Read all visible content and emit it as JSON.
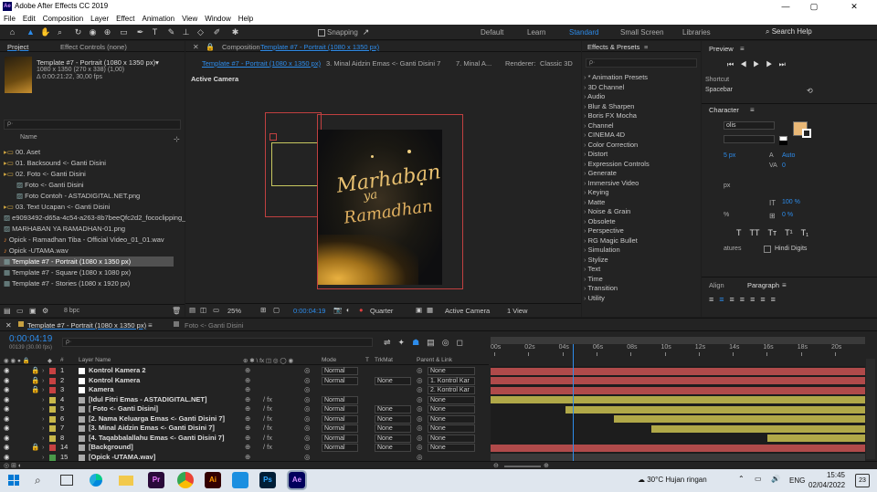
{
  "window": {
    "title": "Adobe After Effects CC 2019",
    "logo": "Ae",
    "min": "—",
    "max": "▢",
    "close": "✕"
  },
  "menu": [
    "File",
    "Edit",
    "Composition",
    "Layer",
    "Effect",
    "Animation",
    "View",
    "Window",
    "Help"
  ],
  "toolbar": {
    "snapping": "Snapping",
    "workspaces": [
      "Default",
      "Learn",
      "Standard",
      "Small Screen",
      "Libraries"
    ],
    "search": "Search Help"
  },
  "project": {
    "tab": "Project",
    "effect_controls": "Effect Controls (none)",
    "comp_name": "Template #7 - Portrait (1080 x 1350 px)▾",
    "comp_info1": "1080 x 1350  (270 x 338) (1,00)",
    "comp_info2": "Δ 0:00:21:22, 30,00 fps",
    "search_placeholder": "ρ·",
    "col_name": "Name",
    "items": [
      {
        "label": "00. Aset",
        "indent": 0,
        "type": "folder"
      },
      {
        "label": "01. Backsound <- Ganti Disini",
        "indent": 0,
        "type": "folder"
      },
      {
        "label": "02. Foto <- Ganti Disini",
        "indent": 0,
        "type": "folder"
      },
      {
        "label": "Foto <- Ganti Disini",
        "indent": 1,
        "type": "image"
      },
      {
        "label": "Foto Contoh - ASTADIGITAL.NET.png",
        "indent": 1,
        "type": "image"
      },
      {
        "label": "03. Text Ucapan <- Ganti Disini",
        "indent": 0,
        "type": "folder"
      },
      {
        "label": "e9093492-d65a-4c54-a263-8b7beeQfc2d2_fococlipping_",
        "indent": 0,
        "type": "image"
      },
      {
        "label": "MARHABAN YA RAMADHAN-01.png",
        "indent": 0,
        "type": "image"
      },
      {
        "label": "Opick - Ramadhan Tiba - Official Video_01_01.wav",
        "indent": 0,
        "type": "audio"
      },
      {
        "label": "Opick -UTAMA.wav",
        "indent": 0,
        "type": "audio"
      },
      {
        "label": "Template #7 - Portrait (1080 x 1350 px)",
        "indent": 0,
        "type": "comp",
        "selected": true
      },
      {
        "label": "Template #7 - Square (1080 x 1080 px)",
        "indent": 0,
        "type": "comp"
      },
      {
        "label": "Template #7 - Stories (1080 x 1920 px)",
        "indent": 0,
        "type": "comp"
      }
    ],
    "bpc": "8 bpc"
  },
  "composition": {
    "tab_prefix": "Composition",
    "tab_name": "Template #7 - Portrait (1080 x 1350 px)",
    "flow": [
      "Template #7 - Portrait (1080 x 1350 px)",
      "3. Minal Aidzin Emas <- Ganti Disini 7",
      "7. Minal A..."
    ],
    "renderer_label": "Renderer:",
    "renderer": "Classic 3D",
    "active_camera": "Active Camera",
    "art_line1": "Marhaban",
    "art_line2": "ya",
    "art_line3": "Ramadhan",
    "footer": {
      "zoom": "25%",
      "time": "0:00:04:19",
      "quality": "Quarter",
      "camera": "Active Camera",
      "view": "1 View"
    }
  },
  "effects": {
    "title": "Effects & Presets",
    "search_placeholder": "ρ·",
    "list": [
      "* Animation Presets",
      "3D Channel",
      "Audio",
      "Blur & Sharpen",
      "Boris FX Mocha",
      "Channel",
      "CINEMA 4D",
      "Color Correction",
      "Distort",
      "Expression Controls",
      "Generate",
      "Immersive Video",
      "Keying",
      "Matte",
      "Noise & Grain",
      "Obsolete",
      "Perspective",
      "RG Magic Bullet",
      "Simulation",
      "Stylize",
      "Text",
      "Time",
      "Transition",
      "Utility"
    ]
  },
  "preview": {
    "title": "Preview",
    "shortcut_label": "Shortcut",
    "shortcut": "Spacebar"
  },
  "character": {
    "title": "Character",
    "font": "olis",
    "size": "5 px",
    "auto": "Auto",
    "kern": "0",
    "px": "px",
    "scale_v": "100 %",
    "scale_h": "%",
    "tsume": "0 %",
    "ligatures": "atures",
    "hindi": "Hindi Digits",
    "fill_color": "#e9b877",
    "styles": [
      "T",
      "TT",
      "Tт",
      "T¹",
      "T₁"
    ]
  },
  "paragraph": {
    "align": "Align",
    "title": "Paragraph"
  },
  "timeline": {
    "tab": "Template #7 - Portrait (1080 x 1350 px)",
    "tab2": "Foto <- Ganti Disini",
    "time": "0:00:04:19",
    "fps": "00139 (30.00 fps)",
    "col_layer": "Layer Name",
    "col_mode": "Mode",
    "col_t": "T",
    "col_trkmat": "TrkMat",
    "col_parent": "Parent & Link",
    "ticks": [
      "00s",
      "02s",
      "04s",
      "06s",
      "08s",
      "10s",
      "12s",
      "14s",
      "16s",
      "18s",
      "20s"
    ],
    "layers": [
      {
        "num": "1",
        "name": "Kontrol Kamera 2",
        "color": "#c74242",
        "mode": "Normal",
        "trk": "",
        "parent": "None",
        "bar": "#b04a4a",
        "start": 0.0,
        "end": 1.0
      },
      {
        "num": "2",
        "name": "Kontrol Kamera",
        "color": "#c74242",
        "mode": "Normal",
        "trk": "None",
        "parent": "1. Kontrol Kar",
        "bar": "#b04a4a",
        "start": 0.0,
        "end": 1.0
      },
      {
        "num": "3",
        "name": "Kamera",
        "color": "#c74242",
        "mode": "",
        "trk": "",
        "parent": "2. Kontrol Kar",
        "bar": "#b04a4a",
        "start": 0.0,
        "end": 1.0
      },
      {
        "num": "4",
        "name": "[Idul Fitri Emas - ASTADIGITAL.NET]",
        "color": "#c8b84a",
        "mode": "Normal",
        "trk": "",
        "parent": "None",
        "bar": "#b0a848",
        "start": 0.0,
        "end": 1.0
      },
      {
        "num": "5",
        "name": "[ Foto <- Ganti Disini]",
        "color": "#c8b84a",
        "mode": "Normal",
        "trk": "None",
        "parent": "None",
        "bar": "#b0a848",
        "start": 0.2,
        "end": 1.0
      },
      {
        "num": "6",
        "name": "[2. Nama Keluarga Emas <- Ganti Disini 7]",
        "color": "#c8b84a",
        "mode": "Normal",
        "trk": "None",
        "parent": "None",
        "bar": "#b0a848",
        "start": 0.33,
        "end": 1.0
      },
      {
        "num": "7",
        "name": "[3. Minal Aidzin Emas <- Ganti Disini 7]",
        "color": "#c8b84a",
        "mode": "Normal",
        "trk": "None",
        "parent": "None",
        "bar": "#b0a848",
        "start": 0.43,
        "end": 1.0
      },
      {
        "num": "8",
        "name": "[4. Taqabbalallahu Emas <- Ganti Disini 7]",
        "color": "#c8b84a",
        "mode": "Normal",
        "trk": "None",
        "parent": "None",
        "bar": "#b0a848",
        "start": 0.74,
        "end": 1.0
      },
      {
        "num": "14",
        "name": "[Background]",
        "color": "#c74242",
        "mode": "Normal",
        "trk": "None",
        "parent": "None",
        "bar": "#b04a4a",
        "start": 0.0,
        "end": 1.0
      },
      {
        "num": "15",
        "name": "[Opick -UTAMA.wav]",
        "color": "#4a9a4a",
        "mode": "",
        "trk": "",
        "parent": "",
        "bar": "#3a3a3a",
        "start": 0.0,
        "end": 1.0
      }
    ],
    "playhead": 0.22
  },
  "taskbar": {
    "weather": "30°C  Hujan ringan",
    "lang": "ENG",
    "time": "15:45",
    "date": "02/04/2022",
    "notif": "23",
    "apps": [
      {
        "label": "Pr",
        "bg": "#2a0a3a",
        "fg": "#ea77ff"
      },
      {
        "label": "",
        "bg": "#f2f2f2",
        "fg": "#000"
      },
      {
        "label": "Ai",
        "bg": "#330000",
        "fg": "#ff9a00"
      },
      {
        "label": "",
        "bg": "#1b8fe0",
        "fg": "#fff"
      },
      {
        "label": "Ps",
        "bg": "#001e36",
        "fg": "#31a8ff"
      },
      {
        "label": "Ae",
        "bg": "#00005b",
        "fg": "#d291ff"
      }
    ]
  }
}
